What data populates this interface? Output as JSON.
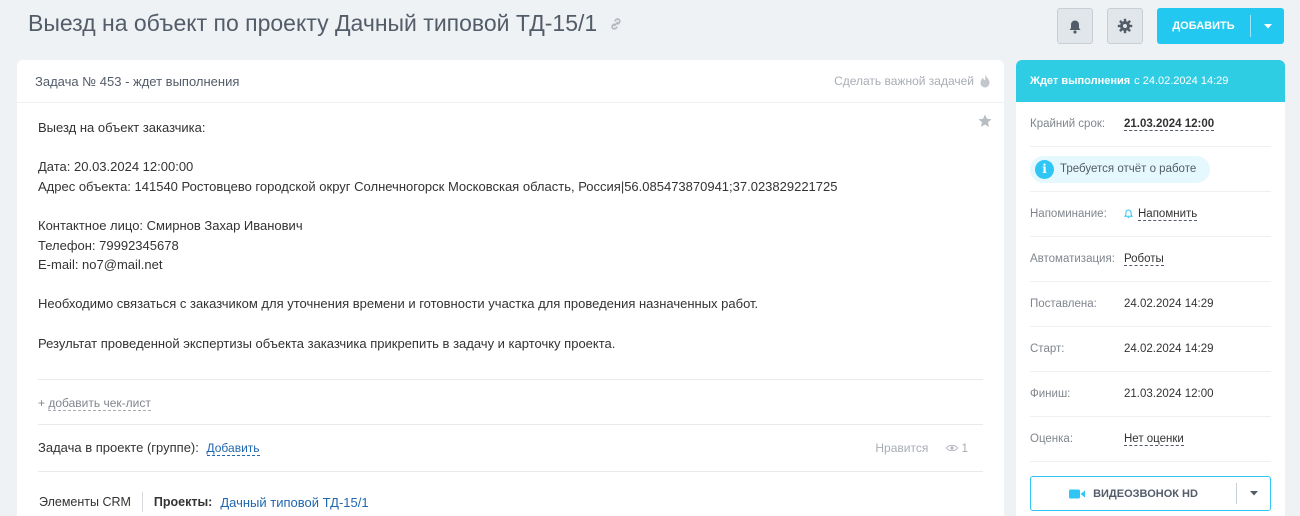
{
  "header": {
    "title": "Выезд на объект по проекту Дачный типовой ТД-15/1",
    "add_label": "ДОБАВИТЬ"
  },
  "task": {
    "number_status": "Задача № 453 - ждет выполнения",
    "make_important": "Сделать важной задачей",
    "description": "Выезд на объект заказчика:\n\nДата: 20.03.2024 12:00:00\nАдрес объекта: 141540 Ростовцево городской округ Солнечногорск Московская область, Россия|56.085473870941;37.023829221725\n\nКонтактное лицо: Смирнов Захар Иванович\nТелефон: 79992345678\nE-mail: no7@mail.net\n\nНеобходимо связаться с заказчиком для уточнения времени и готовности участка для проведения назначенных работ.\n\nРезультат проведенной экспертизы объекта заказчика прикрепить в задачу и карточку проекта.",
    "add_checklist": "добавить чек-лист",
    "project_group_label": "Задача в проекте (группе):",
    "project_group_add": "Добавить",
    "likes_label": "Нравится",
    "views_count": "1",
    "crm_label": "Элементы CRM",
    "projects_label": "Проекты:",
    "project_link": "Дачный типовой ТД-15/1"
  },
  "sidebar": {
    "status": "Ждет выполнения",
    "status_since": "с 24.02.2024 14:29",
    "deadline_label": "Крайний срок:",
    "deadline_value": "21.03.2024 12:00",
    "report_notice": "Требуется отчёт о работе",
    "reminder_label": "Напоминание:",
    "reminder_value": "Напомнить",
    "automation_label": "Автоматизация:",
    "automation_value": "Роботы",
    "created_label": "Поставлена:",
    "created_value": "24.02.2024 14:29",
    "start_label": "Старт:",
    "start_value": "24.02.2024 14:29",
    "finish_label": "Финиш:",
    "finish_value": "21.03.2024 12:00",
    "rating_label": "Оценка:",
    "rating_value": "Нет оценки",
    "video_call": "ВИДЕОЗВОНОК HD"
  },
  "colors": {
    "accent": "#22c8f0",
    "status_header": "#2fcde4",
    "link": "#2067b0"
  },
  "icons": [
    "link-icon",
    "bell-icon",
    "gear-icon",
    "chevron-down-icon",
    "flame-icon",
    "star-icon",
    "eye-icon",
    "info-icon",
    "bell-small-icon",
    "video-camera-icon"
  ]
}
